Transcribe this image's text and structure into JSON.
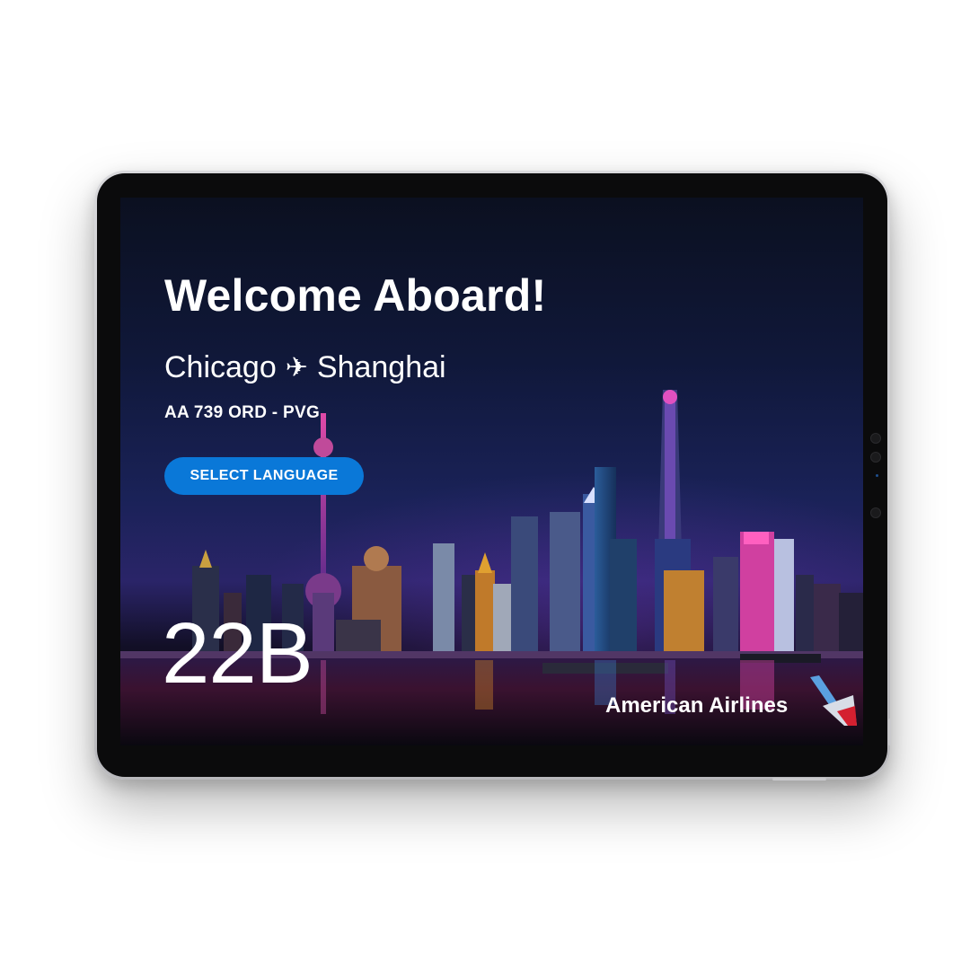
{
  "welcome": {
    "title": "Welcome Aboard!"
  },
  "route": {
    "origin": "Chicago",
    "destination": "Shanghai",
    "icon": "airplane-icon"
  },
  "flight": {
    "code": "AA 739 ORD - PVG"
  },
  "language_button": {
    "label": "SELECT LANGUAGE",
    "color": "#0a78d8"
  },
  "seat": {
    "number": "22B"
  },
  "brand": {
    "name": "American Airlines",
    "logo": "american-airlines-flight-symbol"
  }
}
